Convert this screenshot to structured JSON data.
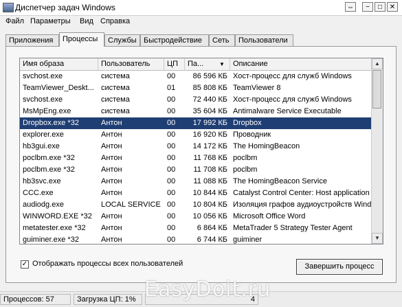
{
  "window": {
    "title": "Диспетчер задач Windows",
    "controls": {
      "restore": "⇔",
      "minimize": "−",
      "maximize": "□",
      "close": "✕"
    }
  },
  "menu": [
    "Файл",
    "Параметры",
    "Вид",
    "Справка"
  ],
  "tabs": [
    {
      "label": "Приложения",
      "active": false
    },
    {
      "label": "Процессы",
      "active": true
    },
    {
      "label": "Службы",
      "active": false
    },
    {
      "label": "Быстродействие",
      "active": false
    },
    {
      "label": "Сеть",
      "active": false
    },
    {
      "label": "Пользователи",
      "active": false
    }
  ],
  "table": {
    "headers": [
      "Имя образа",
      "Пользователь",
      "ЦП",
      "Па...",
      "Описание"
    ],
    "sorted_column_indicator": "▼",
    "rows": [
      {
        "name": "svchost.exe",
        "user": "система",
        "cpu": "00",
        "mem": "86 596 КБ",
        "desc": "Хост-процесс для служб Windows"
      },
      {
        "name": "TeamViewer_Deskt...",
        "user": "система",
        "cpu": "01",
        "mem": "85 808 КБ",
        "desc": "TeamViewer 8"
      },
      {
        "name": "svchost.exe",
        "user": "система",
        "cpu": "00",
        "mem": "72 440 КБ",
        "desc": "Хост-процесс для служб Windows"
      },
      {
        "name": "MsMpEng.exe",
        "user": "система",
        "cpu": "00",
        "mem": "35 604 КБ",
        "desc": "Antimalware Service Executable"
      },
      {
        "name": "Dropbox.exe *32",
        "user": "Антон",
        "cpu": "00",
        "mem": "17 992 КБ",
        "desc": "Dropbox",
        "selected": true
      },
      {
        "name": "explorer.exe",
        "user": "Антон",
        "cpu": "00",
        "mem": "16 920 КБ",
        "desc": "Проводник"
      },
      {
        "name": "hb3gui.exe",
        "user": "Антон",
        "cpu": "00",
        "mem": "14 172 КБ",
        "desc": "The HomingBeacon"
      },
      {
        "name": "poclbm.exe *32",
        "user": "Антон",
        "cpu": "00",
        "mem": "11 768 КБ",
        "desc": "poclbm"
      },
      {
        "name": "poclbm.exe *32",
        "user": "Антон",
        "cpu": "00",
        "mem": "11 708 КБ",
        "desc": "poclbm"
      },
      {
        "name": "hb3svc.exe",
        "user": "Антон",
        "cpu": "00",
        "mem": "11 088 КБ",
        "desc": "The HomingBeacon Service"
      },
      {
        "name": "CCC.exe",
        "user": "Антон",
        "cpu": "00",
        "mem": "10 844 КБ",
        "desc": "Catalyst Control Center: Host application"
      },
      {
        "name": "audiodg.exe",
        "user": "LOCAL SERVICE",
        "cpu": "00",
        "mem": "10 804 КБ",
        "desc": "Изоляция графов аудиоустройств Windo"
      },
      {
        "name": "WINWORD.EXE *32",
        "user": "Антон",
        "cpu": "00",
        "mem": "10 056 КБ",
        "desc": "Microsoft Office Word"
      },
      {
        "name": "metatester.exe *32",
        "user": "Антон",
        "cpu": "00",
        "mem": "6 864 КБ",
        "desc": "MetaTrader 5 Strategy Tester Agent"
      },
      {
        "name": "guiminer.exe *32",
        "user": "Антон",
        "cpu": "00",
        "mem": "6 744 КБ",
        "desc": "guiminer"
      }
    ]
  },
  "show_all_users": {
    "checked": true,
    "label": "Отображать процессы всех пользователей"
  },
  "end_process_button": "Завершить процесс",
  "statusbar": [
    "Процессов: 57",
    "Загрузка ЦП: 1%",
    "4"
  ],
  "watermark": "EasyDoit.ru"
}
